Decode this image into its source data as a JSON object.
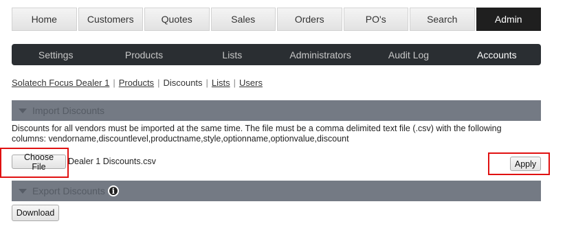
{
  "top_nav": [
    {
      "label": "Home",
      "active": false
    },
    {
      "label": "Customers",
      "active": false
    },
    {
      "label": "Quotes",
      "active": false
    },
    {
      "label": "Sales",
      "active": false
    },
    {
      "label": "Orders",
      "active": false
    },
    {
      "label": "PO's",
      "active": false
    },
    {
      "label": "Search",
      "active": false
    },
    {
      "label": "Admin",
      "active": true
    }
  ],
  "sub_nav": [
    {
      "label": "Settings",
      "active": false
    },
    {
      "label": "Products",
      "active": false
    },
    {
      "label": "Lists",
      "active": false
    },
    {
      "label": "Administrators",
      "active": false
    },
    {
      "label": "Audit Log",
      "active": false
    },
    {
      "label": "Accounts",
      "active": true
    }
  ],
  "breadcrumb": {
    "items": [
      "Solatech Focus Dealer 1",
      "Products",
      "Discounts",
      "Lists",
      "Users"
    ],
    "separator": "|",
    "current_index": 2
  },
  "import_section": {
    "title": "Import Discounts",
    "description": "Discounts for all vendors must be imported at the same time. The file must be a comma delimited text file (.csv) with the following columns: vendorname,discountlevel,productname,style,optionname,optionvalue,discount",
    "choose_file_label": "Choose File",
    "file_name": "Dealer 1 Discounts.csv",
    "apply_label": "Apply"
  },
  "export_section": {
    "title": "Export Discounts",
    "info_glyph": "i",
    "download_label": "Download"
  },
  "colors": {
    "section_header_bg": "#747a84",
    "active_tab_bg": "#1f1f1f",
    "subnav_bg": "#2a2e32",
    "highlight_box": "#e01010"
  }
}
